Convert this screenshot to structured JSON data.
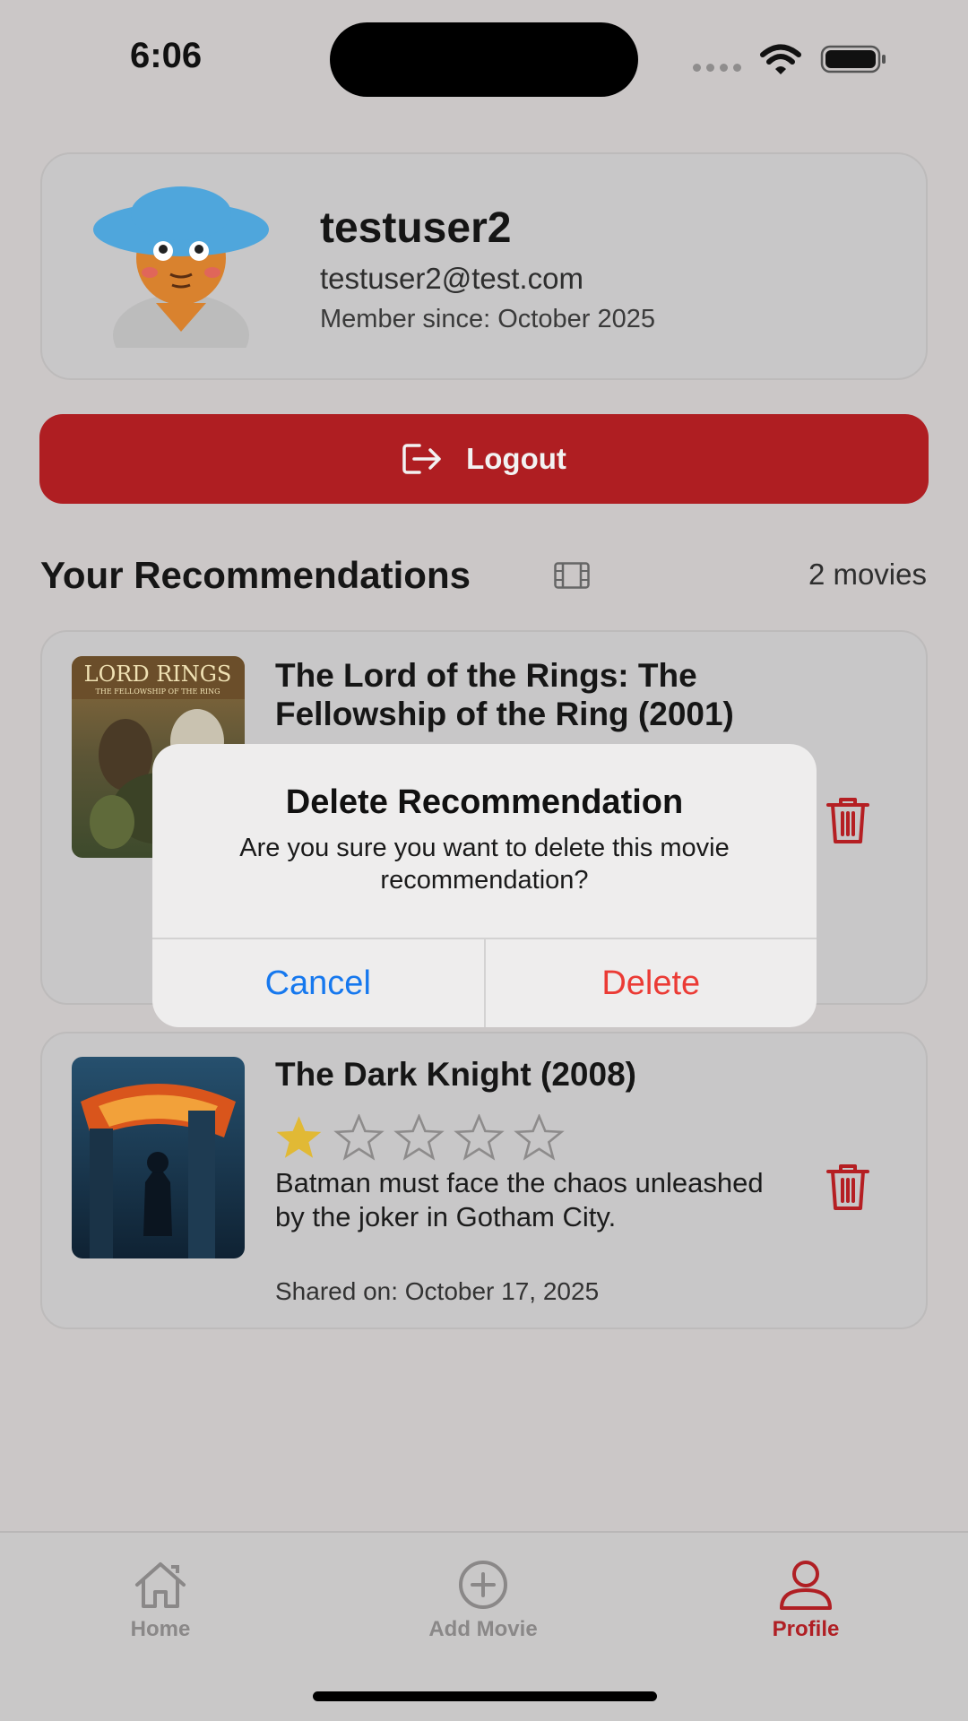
{
  "status_bar": {
    "time": "6:06",
    "icons": [
      "signal-dots-icon",
      "wifi-icon",
      "battery-icon"
    ]
  },
  "profile": {
    "username": "testuser2",
    "email": "testuser2@test.com",
    "member_since": "Member since: October 2025",
    "avatar": "avatar-illustration"
  },
  "logout": {
    "label": "Logout",
    "icon": "logout-icon"
  },
  "recommendations": {
    "title": "Your Recommendations",
    "count": "2 movies",
    "items": [
      {
        "title": "The Lord of the Rings: The Fellowship of the Ring (2001)",
        "visible_title": "The Lord of the Rings: The Fellowship of the Ring",
        "poster": "lotr-poster"
      },
      {
        "title": "The Dark Knight (2008)",
        "rating": 1,
        "rating_max": 5,
        "description": "Batman must face the chaos unleashed by the joker in Gotham City.",
        "shared_on": "Shared on: October 17, 2025",
        "poster": "dark-knight-poster"
      }
    ]
  },
  "alert": {
    "title": "Delete Recommendation",
    "message": "Are you sure you want to delete this movie recommendation?",
    "cancel_label": "Cancel",
    "delete_label": "Delete"
  },
  "tab_bar": {
    "tabs": [
      {
        "label": "Home",
        "icon": "home-icon",
        "active": false
      },
      {
        "label": "Add Movie",
        "icon": "plus-circle-icon",
        "active": false
      },
      {
        "label": "Profile",
        "icon": "person-icon",
        "active": true
      }
    ]
  },
  "colors": {
    "accent": "#af1e22",
    "background": "#cbc7c7",
    "alert_cancel": "#1678ee",
    "alert_delete": "#eb3b35",
    "star_filled": "#e1b935"
  }
}
